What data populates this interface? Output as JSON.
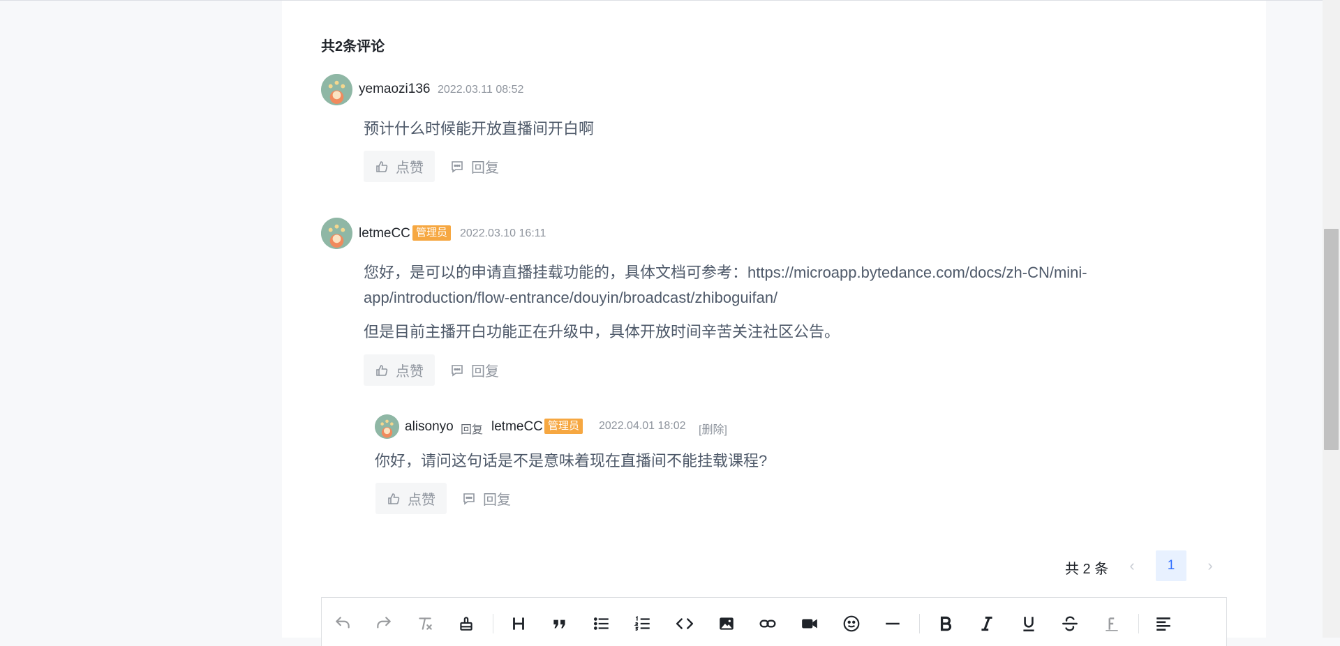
{
  "comments_header": {
    "title": "共2条评论"
  },
  "comments": [
    {
      "author": "yemaozi136",
      "time": "2022.03.11 08:52",
      "text": "预计什么时候能开放直播间开白啊",
      "like_label": "点赞",
      "reply_label": "回复"
    },
    {
      "author": "letmeCC",
      "badge": "管理员",
      "time": "2022.03.10 16:11",
      "text_line1": "您好，是可以的申请直播挂载功能的，具体文档可参考：https://microapp.bytedance.com/docs/zh-CN/mini-",
      "text_line2": "app/introduction/flow-entrance/douyin/broadcast/zhiboguifan/",
      "text_para2": "但是目前主播开白功能正在升级中，具体开放时间辛苦关注社区公告。",
      "like_label": "点赞",
      "reply_label": "回复",
      "replies": [
        {
          "author": "alisonyo",
          "reply_word": "回复",
          "reply_to": "letmeCC",
          "badge": "管理员",
          "time": "2022.04.01 18:02",
          "delete_label": "[删除]",
          "text": "你好，请问这句话是不是意味着现在直播间不能挂载课程?",
          "like_label": "点赞",
          "reply_label": "回复"
        }
      ]
    }
  ],
  "pagination": {
    "total": "共 2 条",
    "current_page": "1",
    "prev_symbol": "‹",
    "next_symbol": "›"
  },
  "toolbar": {
    "items": [
      "undo-icon",
      "redo-icon",
      "clear-format-icon",
      "format-painter-icon",
      "heading-icon",
      "quote-icon",
      "bullet-list-icon",
      "numbered-list-icon",
      "code-icon",
      "image-icon",
      "link-icon",
      "video-icon",
      "emoji-icon",
      "divider-icon",
      "bold-icon",
      "italic-icon",
      "underline-icon",
      "strikethrough-icon",
      "text-color-icon",
      "align-left-icon"
    ]
  },
  "colors": {
    "badge": "#f6a741",
    "accent": "#3370ff",
    "page_active_bg": "#e8f1ff"
  }
}
